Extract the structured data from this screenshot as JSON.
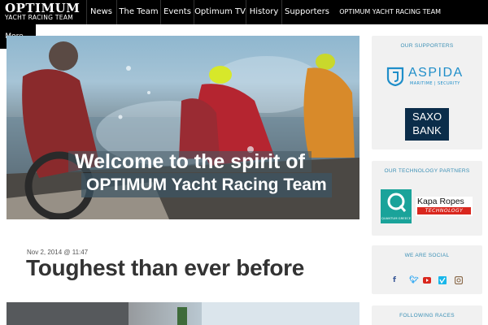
{
  "brand": {
    "name": "OPTIMUM",
    "tagline": "YACHT RACING TEAM"
  },
  "nav": {
    "items": [
      "News",
      "The Team",
      "Events",
      "Optimum TV",
      "History",
      "Supporters"
    ],
    "right_label": "OPTIMUM YACHT RACING TEAM",
    "more_label": "More…"
  },
  "hero": {
    "line1": "Welcome to the spirit of",
    "line2": "OPTIMUM Yacht Racing Team"
  },
  "post": {
    "date": "Nov 2, 2014 @ 11:47",
    "title": "Toughest than ever before"
  },
  "sidebar": {
    "supporters": {
      "title": "OUR SUPPORTERS",
      "aspida_name": "ASPIDA",
      "aspida_sub": "MARITIME | SECURITY",
      "saxo_line1": "SAXO",
      "saxo_line2": "BANK"
    },
    "tech": {
      "title": "OUR TECHNOLOGY PARTNERS",
      "quantum_label": "QUANTUM GREECE",
      "kapa_name": "Kapa Ropes",
      "kapa_sub": "TECHNOLOGY"
    },
    "social": {
      "title": "WE ARE SOCIAL",
      "icons": [
        "facebook-icon",
        "twitter-icon",
        "youtube-icon",
        "vimeo-icon",
        "instagram-icon"
      ]
    },
    "races": {
      "title": "FOLLOWING RACES"
    }
  },
  "colors": {
    "nav_bg": "#000000",
    "accent_blue": "#3a8fb5",
    "aspida_blue": "#1f8ec9",
    "saxo_navy": "#0b2d4a",
    "quantum_teal": "#1aa39a",
    "kapa_red": "#d9271e"
  }
}
